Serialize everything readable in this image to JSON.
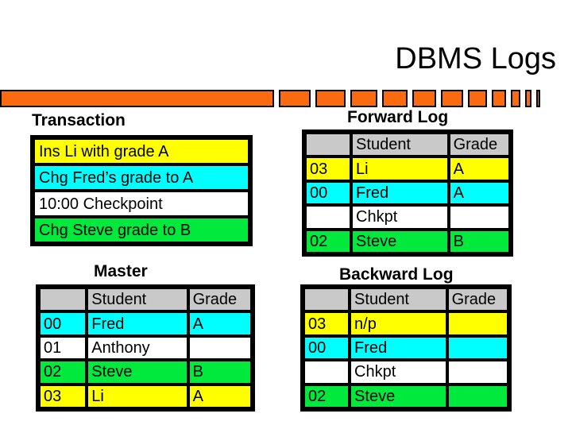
{
  "slide": {
    "title": "DBMS Logs"
  },
  "divider": {
    "color": "#fa6a0f",
    "border_color": "#000000",
    "segments": [
      345,
      40,
      38,
      34,
      32,
      30,
      28,
      24,
      18,
      12,
      8,
      5
    ],
    "gaps": [
      6,
      6,
      6,
      6,
      6,
      6,
      6,
      6,
      6,
      6,
      6
    ]
  },
  "palette": {
    "yellow": "#ffff00",
    "cyan": "#00ffff",
    "green": "#00e93c",
    "white": "#ffffff",
    "gray": "#c9c9c9",
    "orange": "#fa6a0f",
    "black": "#000000"
  },
  "transaction": {
    "heading": "Transaction",
    "rows": [
      {
        "text": "Ins Li with grade A",
        "fill": "yellow"
      },
      {
        "text": "Chg Fred’s grade to A",
        "fill": "cyan"
      },
      {
        "text": "10:00 Checkpoint",
        "fill": "white"
      },
      {
        "text": "Chg Steve grade to B",
        "fill": "green"
      }
    ]
  },
  "forward_log": {
    "heading": "Forward Log",
    "columns": [
      "",
      "Student",
      "Grade"
    ],
    "rows": [
      {
        "id": "03",
        "student": "Li",
        "grade": "A",
        "fill": "yellow"
      },
      {
        "id": "00",
        "student": "Fred",
        "grade": "A",
        "fill": "cyan"
      },
      {
        "id": "",
        "student": "Chkpt",
        "grade": "",
        "fill": "white"
      },
      {
        "id": "02",
        "student": "Steve",
        "grade": "B",
        "fill": "green"
      }
    ]
  },
  "master": {
    "heading": "Master",
    "columns": [
      "",
      "Student",
      "Grade"
    ],
    "rows": [
      {
        "id": "00",
        "student": "Fred",
        "grade": "A",
        "fill": "cyan"
      },
      {
        "id": "01",
        "student": "Anthony",
        "grade": "",
        "fill": "white"
      },
      {
        "id": "02",
        "student": "Steve",
        "grade": "B",
        "fill": "green"
      },
      {
        "id": "03",
        "student": "Li",
        "grade": "A",
        "fill": "yellow"
      }
    ]
  },
  "backward_log": {
    "heading": "Backward Log",
    "columns": [
      "",
      "Student",
      "Grade"
    ],
    "rows": [
      {
        "id": "03",
        "student": "n/p",
        "grade": "",
        "fill": "yellow"
      },
      {
        "id": "00",
        "student": "Fred",
        "grade": "",
        "fill": "cyan"
      },
      {
        "id": "",
        "student": "Chkpt",
        "grade": "",
        "fill": "white"
      },
      {
        "id": "02",
        "student": "Steve",
        "grade": "",
        "fill": "green"
      }
    ]
  }
}
